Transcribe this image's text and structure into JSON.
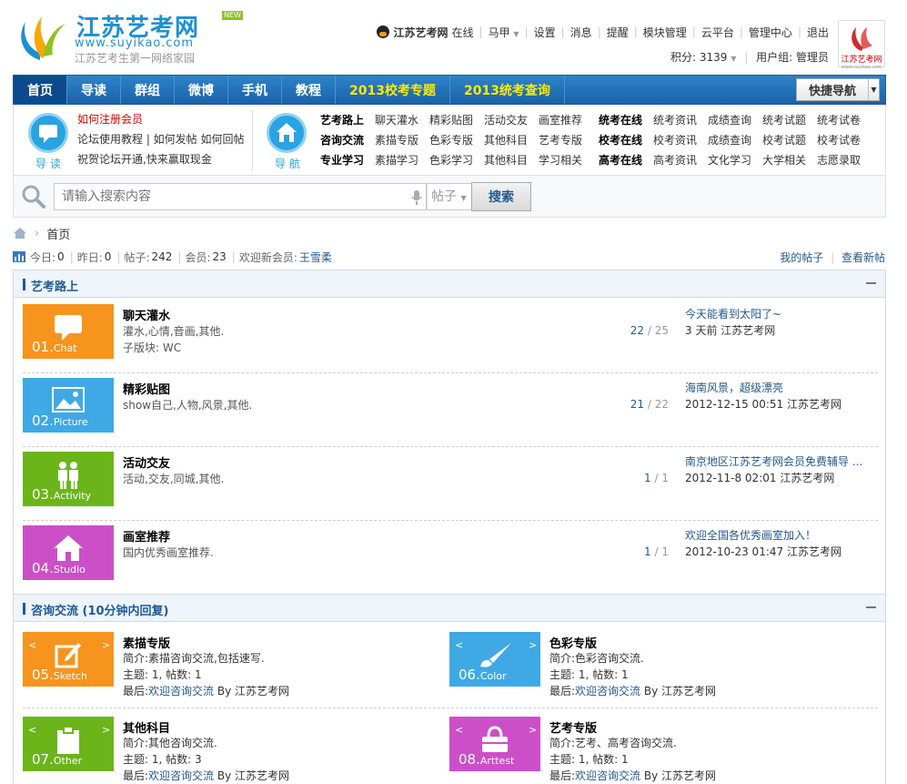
{
  "header": {
    "logo_title": "江苏艺考网",
    "logo_new": "NEW",
    "logo_url": "www.suyikao.com",
    "logo_sub": "江苏艺考生第一网络家园",
    "site_name": "江苏艺考网",
    "online": "在线",
    "user": "马甲",
    "links": [
      "设置",
      "消息",
      "提醒",
      "模块管理",
      "云平台",
      "管理中心",
      "退出"
    ],
    "credits_label": "积分: 3139",
    "group_label": "用户组: 管理员",
    "avatar_text": "江苏艺考网",
    "avatar_sub": "www.suyikao.com"
  },
  "nav": {
    "items": [
      {
        "label": "首页"
      },
      {
        "label": "导读"
      },
      {
        "label": "群组"
      },
      {
        "label": "微博"
      },
      {
        "label": "手机"
      },
      {
        "label": "教程"
      },
      {
        "label": "2013校考专题"
      },
      {
        "label": "2013统考查询"
      }
    ],
    "quick_nav": "快捷导航"
  },
  "guide": {
    "left_label": "导读",
    "left_links": [
      "如何注册会员",
      "论坛使用教程 | 如何发帖 如何回帖",
      "祝贺论坛开通,快来赢取现金"
    ],
    "right_label": "导航",
    "grid": [
      [
        "艺考路上",
        "聊天灌水",
        "精彩贴图",
        "活动交友",
        "画室推荐",
        "统考在线",
        "统考资讯",
        "成绩查询",
        "统考试题",
        "统考试卷"
      ],
      [
        "咨询交流",
        "素描专版",
        "色彩专版",
        "其他科目",
        "艺考专版",
        "校考在线",
        "校考资讯",
        "成绩查询",
        "校考试题",
        "校考试卷"
      ],
      [
        "专业学习",
        "素描学习",
        "色彩学习",
        "其他科目",
        "学习相关",
        "高考在线",
        "高考资讯",
        "文化学习",
        "大学相关",
        "志愿录取"
      ]
    ]
  },
  "search": {
    "placeholder": "请输入搜索内容",
    "type": "帖子",
    "button": "搜索"
  },
  "breadcrumb": {
    "current": "首页"
  },
  "stats": {
    "today_label": "今日:",
    "today": "0",
    "yesterday_label": "昨日:",
    "yesterday": "0",
    "posts_label": "帖子:",
    "posts": "242",
    "members_label": "会员:",
    "members": "23",
    "welcome_label": "欢迎新会员:",
    "new_member": "王雪柔",
    "my_posts": "我的帖子",
    "new_posts": "查看新帖"
  },
  "section1": {
    "title": "艺考路上",
    "forums": [
      {
        "num": "01",
        "en": "Chat",
        "color": "#f7941d",
        "name": "聊天灌水",
        "desc": "灌水,心情,音画,其他.",
        "sub": "子版块: WC",
        "threads": "22",
        "posts": "25",
        "last": "今天能看到太阳了~",
        "time": "3 天前 江苏艺考网"
      },
      {
        "num": "02",
        "en": "Picture",
        "color": "#3fa9e5",
        "name": "精彩贴图",
        "desc": "show自己,人物,风景,其他.",
        "sub": "",
        "threads": "21",
        "posts": "22",
        "last": "海南风景，超级漂亮",
        "time": "2012-12-15 00:51 江苏艺考网"
      },
      {
        "num": "03",
        "en": "Activity",
        "color": "#6bb51b",
        "name": "活动交友",
        "desc": "活动,交友,同城,其他.",
        "sub": "",
        "threads": "1",
        "posts": "1",
        "last": "南京地区江苏艺考网会员免费辅导 ...",
        "time": "2012-11-8 02:01 江苏艺考网"
      },
      {
        "num": "04",
        "en": "Studio",
        "color": "#cc4fc8",
        "name": "画室推荐",
        "desc": "国内优秀画室推荐.",
        "sub": "",
        "threads": "1",
        "posts": "1",
        "last": "欢迎全国各优秀画室加入！",
        "time": "2012-10-23 01:47 江苏艺考网"
      }
    ]
  },
  "section2": {
    "title": "咨询交流 (10分钟内回复)",
    "forums": [
      {
        "num": "05",
        "en": "Sketch",
        "color": "#f7941d",
        "name": "素描专版",
        "intro": "简介:素描咨询交流,包括速写.",
        "stat": "主题: 1, 帖数: 1",
        "last_label": "最后:",
        "last": "欢迎咨询交流",
        "by": "By 江苏艺考网"
      },
      {
        "num": "06",
        "en": "Color",
        "color": "#3fa9e5",
        "name": "色彩专版",
        "intro": "简介:色彩咨询交流.",
        "stat": "主题: 1, 帖数: 1",
        "last_label": "最后:",
        "last": "欢迎咨询交流",
        "by": "By 江苏艺考网"
      },
      {
        "num": "07",
        "en": "Other",
        "color": "#6bb51b",
        "name": "其他科目",
        "intro": "简介:其他咨询交流.",
        "stat": "主题: 1, 帖数: 3",
        "last_label": "最后:",
        "last": "欢迎咨询交流",
        "by": "By 江苏艺考网"
      },
      {
        "num": "08",
        "en": "Arttest",
        "color": "#cc4fc8",
        "name": "艺考专版",
        "intro": "简介:艺考、高考咨询交流.",
        "stat": "主题: 1, 帖数: 1",
        "last_label": "最后:",
        "last": "欢迎咨询交流",
        "by": "By 江苏艺考网"
      }
    ]
  }
}
